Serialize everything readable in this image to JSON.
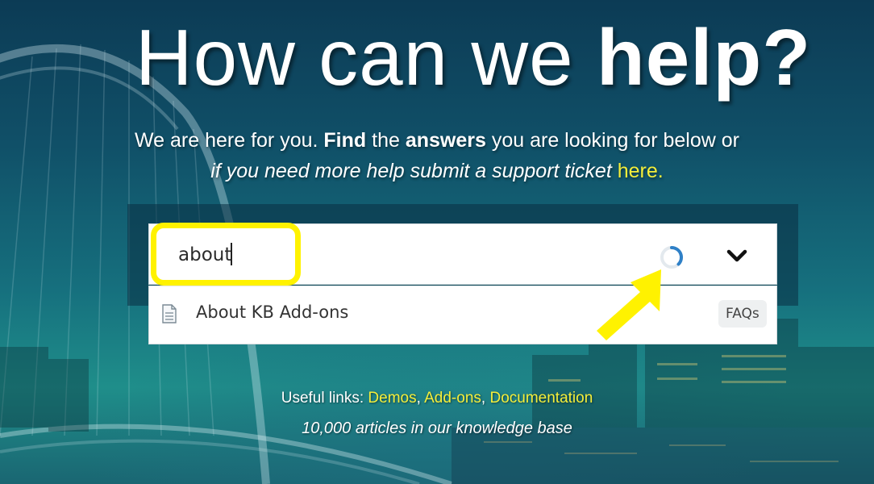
{
  "hero": {
    "title_regular": "How can we ",
    "title_bold": "help?",
    "line1": [
      "We are here for you. ",
      "Find",
      " the ",
      "answers",
      " you are looking for below or"
    ],
    "line2_text": "if you need more help submit a support ticket ",
    "line2_link": "here."
  },
  "search": {
    "value": "about",
    "status": "loading"
  },
  "results": [
    {
      "icon": "document-icon",
      "title": "About KB Add-ons",
      "badge": "FAQs"
    }
  ],
  "footer": {
    "links_label": "Useful links: ",
    "links": [
      "Demos",
      "Add-ons",
      "Documentation"
    ],
    "separator": ", ",
    "article_count_text": "10,000 articles in our knowledge base"
  },
  "colors": {
    "accent_yellow": "#f4ee3a",
    "annotation_yellow": "#fff200",
    "spinner_blue": "#2f80c7"
  }
}
